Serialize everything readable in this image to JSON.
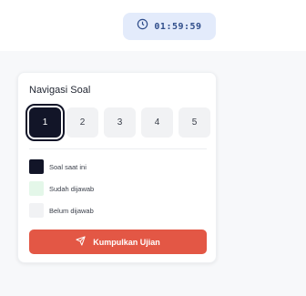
{
  "timer": {
    "icon": "clock-icon",
    "value": "01:59:59"
  },
  "nav": {
    "title": "Navigasi Soal",
    "questions": [
      "1",
      "2",
      "3",
      "4",
      "5"
    ],
    "current_index": 0
  },
  "legend": {
    "current": "Soal saat ini",
    "answered": "Sudah dijawab",
    "unanswered": "Belum dijawab"
  },
  "submit": {
    "icon": "send-icon",
    "label": "Kumpulkan Ujian"
  },
  "colors": {
    "current": "#121528",
    "answered": "#e4f7e9",
    "unanswered": "#f1f2f4",
    "submit": "#e35745",
    "timer_bg": "#e3ebfb"
  }
}
